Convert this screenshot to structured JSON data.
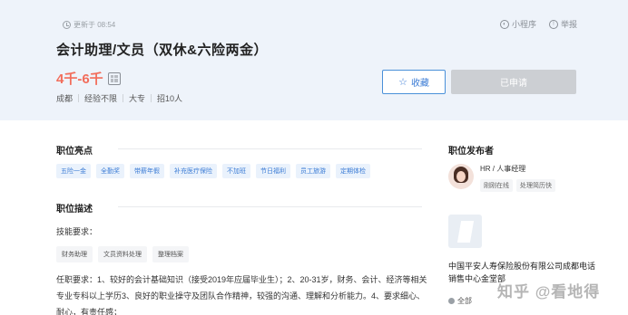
{
  "header": {
    "updated": "更新于 08:54",
    "mini_program": "小程序",
    "report": "举报",
    "title": "会计助理/文员（双休&六险两金）",
    "salary": "4千-6千",
    "meta": [
      "成都",
      "经验不限",
      "大专",
      "招10人"
    ],
    "favorite_label": "收藏",
    "applied_label": "已申请"
  },
  "highlights": {
    "title": "职位亮点",
    "tags": [
      "五险一金",
      "全勤奖",
      "带薪年假",
      "补充医疗保险",
      "不加班",
      "节日福利",
      "员工旅游",
      "定期体检"
    ]
  },
  "description": {
    "title": "职位描述",
    "skills_label": "技能要求：",
    "skills": [
      "财务助理",
      "文员资料处理",
      "整理档案"
    ],
    "text": "任职要求：1、较好的会计基础知识（接受2019年应届毕业生）；2、20-31岁，财务、会计、经济等相关专业专科以上学历3、良好的职业操守及团队合作精神，较强的沟通、理解和分析能力。4、要求细心、耐心，有责任感；"
  },
  "publisher": {
    "title": "职位发布者",
    "role": "HR / 人事经理",
    "badges": [
      "刚刚在线",
      "处理简历快"
    ]
  },
  "company": {
    "name": "中国平安人寿保险股份有限公司成都电话销售中心金堂部",
    "category": "全部"
  },
  "watermark": "知乎 @看地得"
}
